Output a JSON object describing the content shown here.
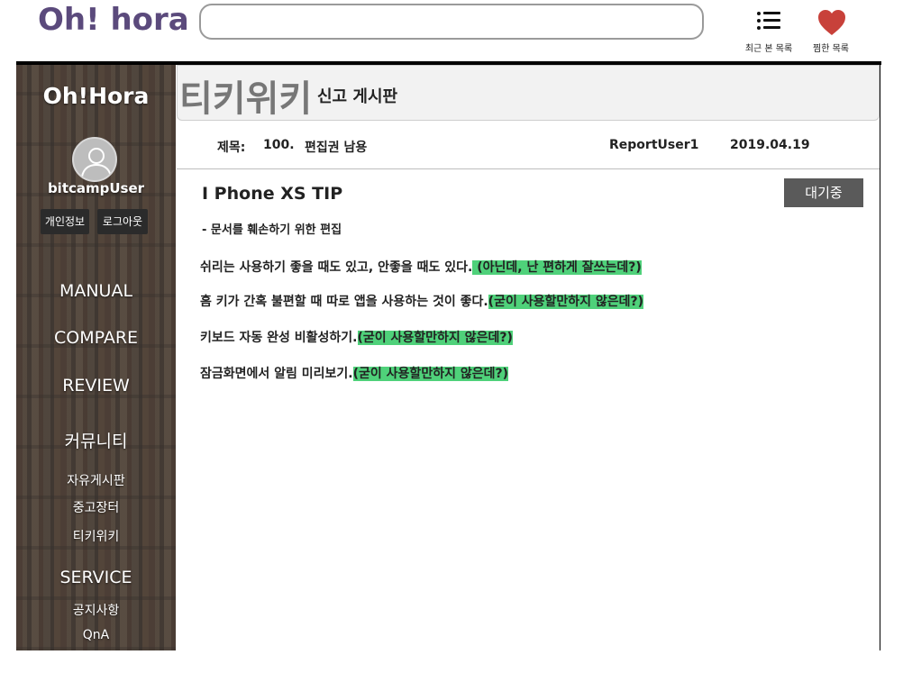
{
  "header": {
    "logo": "Oh! hora",
    "search": {
      "value": "",
      "placeholder": ""
    },
    "recent_label": "최근 본 목록",
    "wish_label": "찜한 목록",
    "colors": {
      "logo": "#5b4a7c",
      "heart": "#c8413a"
    }
  },
  "sidebar": {
    "brand": "Oh!Hora",
    "username": "bitcampUser",
    "profile_button": "개인정보",
    "logout_button": "로그아웃",
    "nav": {
      "manual": "MANUAL",
      "compare": "COMPARE",
      "review": "REVIEW",
      "community": "커뮤니티",
      "free_board": "자유게시판",
      "market": "중고장터",
      "wiki": "티키위키",
      "service": "SERVICE",
      "notice": "공지사항",
      "qna": "QnA"
    }
  },
  "page": {
    "title": "티키위키",
    "subtitle": "신고 게시판"
  },
  "post": {
    "meta_label": "제목:",
    "number": "100.",
    "title": "편집권 남용",
    "author": "ReportUser1",
    "date": "2019.04.19",
    "heading": "I Phone XS TIP",
    "status": "대기중",
    "reason": "- 문서를 훼손하기 위한 편집",
    "lines": [
      {
        "text": "쉬리는 사용하기 좋을 때도 있고, 안좋을 때도 있다.",
        "highlight": " (아닌데, 난 편하게 잘쓰는데?)"
      },
      {
        "text": "홈 키가 간혹 불편할 때 따로 앱을 사용하는 것이 좋다.",
        "highlight": "(굳이 사용할만하지 않은데?)"
      },
      {
        "text": "키보드 자동 완성 비활성하기.",
        "highlight": "(굳이 사용할만하지 않은데?)"
      },
      {
        "text": "잠금화면에서 알림 미리보기.",
        "highlight": "(굳이 사용할만하지 않은데?)"
      }
    ],
    "highlight_color": "#4fd17a"
  }
}
